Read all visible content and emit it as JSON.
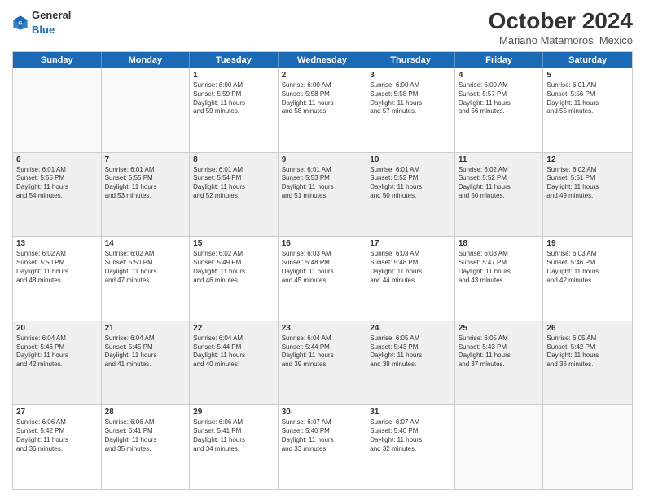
{
  "logo": {
    "general": "General",
    "blue": "Blue"
  },
  "title": "October 2024",
  "subtitle": "Mariano Matamoros, Mexico",
  "header_days": [
    "Sunday",
    "Monday",
    "Tuesday",
    "Wednesday",
    "Thursday",
    "Friday",
    "Saturday"
  ],
  "rows": [
    [
      {
        "day": "",
        "text": "",
        "empty": true
      },
      {
        "day": "",
        "text": "",
        "empty": true
      },
      {
        "day": "1",
        "text": "Sunrise: 6:00 AM\nSunset: 5:59 PM\nDaylight: 11 hours\nand 59 minutes.",
        "shaded": false
      },
      {
        "day": "2",
        "text": "Sunrise: 6:00 AM\nSunset: 5:58 PM\nDaylight: 11 hours\nand 58 minutes.",
        "shaded": false
      },
      {
        "day": "3",
        "text": "Sunrise: 6:00 AM\nSunset: 5:58 PM\nDaylight: 11 hours\nand 57 minutes.",
        "shaded": false
      },
      {
        "day": "4",
        "text": "Sunrise: 6:00 AM\nSunset: 5:57 PM\nDaylight: 11 hours\nand 56 minutes.",
        "shaded": false
      },
      {
        "day": "5",
        "text": "Sunrise: 6:01 AM\nSunset: 5:56 PM\nDaylight: 11 hours\nand 55 minutes.",
        "shaded": false
      }
    ],
    [
      {
        "day": "6",
        "text": "Sunrise: 6:01 AM\nSunset: 5:55 PM\nDaylight: 11 hours\nand 54 minutes.",
        "shaded": true
      },
      {
        "day": "7",
        "text": "Sunrise: 6:01 AM\nSunset: 5:55 PM\nDaylight: 11 hours\nand 53 minutes.",
        "shaded": true
      },
      {
        "day": "8",
        "text": "Sunrise: 6:01 AM\nSunset: 5:54 PM\nDaylight: 11 hours\nand 52 minutes.",
        "shaded": true
      },
      {
        "day": "9",
        "text": "Sunrise: 6:01 AM\nSunset: 5:53 PM\nDaylight: 11 hours\nand 51 minutes.",
        "shaded": true
      },
      {
        "day": "10",
        "text": "Sunrise: 6:01 AM\nSunset: 5:52 PM\nDaylight: 11 hours\nand 50 minutes.",
        "shaded": true
      },
      {
        "day": "11",
        "text": "Sunrise: 6:02 AM\nSunset: 5:52 PM\nDaylight: 11 hours\nand 50 minutes.",
        "shaded": true
      },
      {
        "day": "12",
        "text": "Sunrise: 6:02 AM\nSunset: 5:51 PM\nDaylight: 11 hours\nand 49 minutes.",
        "shaded": true
      }
    ],
    [
      {
        "day": "13",
        "text": "Sunrise: 6:02 AM\nSunset: 5:50 PM\nDaylight: 11 hours\nand 48 minutes.",
        "shaded": false
      },
      {
        "day": "14",
        "text": "Sunrise: 6:02 AM\nSunset: 5:50 PM\nDaylight: 11 hours\nand 47 minutes.",
        "shaded": false
      },
      {
        "day": "15",
        "text": "Sunrise: 6:02 AM\nSunset: 5:49 PM\nDaylight: 11 hours\nand 46 minutes.",
        "shaded": false
      },
      {
        "day": "16",
        "text": "Sunrise: 6:03 AM\nSunset: 5:48 PM\nDaylight: 11 hours\nand 45 minutes.",
        "shaded": false
      },
      {
        "day": "17",
        "text": "Sunrise: 6:03 AM\nSunset: 5:48 PM\nDaylight: 11 hours\nand 44 minutes.",
        "shaded": false
      },
      {
        "day": "18",
        "text": "Sunrise: 6:03 AM\nSunset: 5:47 PM\nDaylight: 11 hours\nand 43 minutes.",
        "shaded": false
      },
      {
        "day": "19",
        "text": "Sunrise: 6:03 AM\nSunset: 5:46 PM\nDaylight: 11 hours\nand 42 minutes.",
        "shaded": false
      }
    ],
    [
      {
        "day": "20",
        "text": "Sunrise: 6:04 AM\nSunset: 5:46 PM\nDaylight: 11 hours\nand 42 minutes.",
        "shaded": true
      },
      {
        "day": "21",
        "text": "Sunrise: 6:04 AM\nSunset: 5:45 PM\nDaylight: 11 hours\nand 41 minutes.",
        "shaded": true
      },
      {
        "day": "22",
        "text": "Sunrise: 6:04 AM\nSunset: 5:44 PM\nDaylight: 11 hours\nand 40 minutes.",
        "shaded": true
      },
      {
        "day": "23",
        "text": "Sunrise: 6:04 AM\nSunset: 5:44 PM\nDaylight: 11 hours\nand 39 minutes.",
        "shaded": true
      },
      {
        "day": "24",
        "text": "Sunrise: 6:05 AM\nSunset: 5:43 PM\nDaylight: 11 hours\nand 38 minutes.",
        "shaded": true
      },
      {
        "day": "25",
        "text": "Sunrise: 6:05 AM\nSunset: 5:43 PM\nDaylight: 11 hours\nand 37 minutes.",
        "shaded": true
      },
      {
        "day": "26",
        "text": "Sunrise: 6:05 AM\nSunset: 5:42 PM\nDaylight: 11 hours\nand 36 minutes.",
        "shaded": true
      }
    ],
    [
      {
        "day": "27",
        "text": "Sunrise: 6:06 AM\nSunset: 5:42 PM\nDaylight: 11 hours\nand 36 minutes.",
        "shaded": false
      },
      {
        "day": "28",
        "text": "Sunrise: 6:06 AM\nSunset: 5:41 PM\nDaylight: 11 hours\nand 35 minutes.",
        "shaded": false
      },
      {
        "day": "29",
        "text": "Sunrise: 6:06 AM\nSunset: 5:41 PM\nDaylight: 11 hours\nand 34 minutes.",
        "shaded": false
      },
      {
        "day": "30",
        "text": "Sunrise: 6:07 AM\nSunset: 5:40 PM\nDaylight: 11 hours\nand 33 minutes.",
        "shaded": false
      },
      {
        "day": "31",
        "text": "Sunrise: 6:07 AM\nSunset: 5:40 PM\nDaylight: 11 hours\nand 32 minutes.",
        "shaded": false
      },
      {
        "day": "",
        "text": "",
        "empty": true
      },
      {
        "day": "",
        "text": "",
        "empty": true
      }
    ]
  ]
}
